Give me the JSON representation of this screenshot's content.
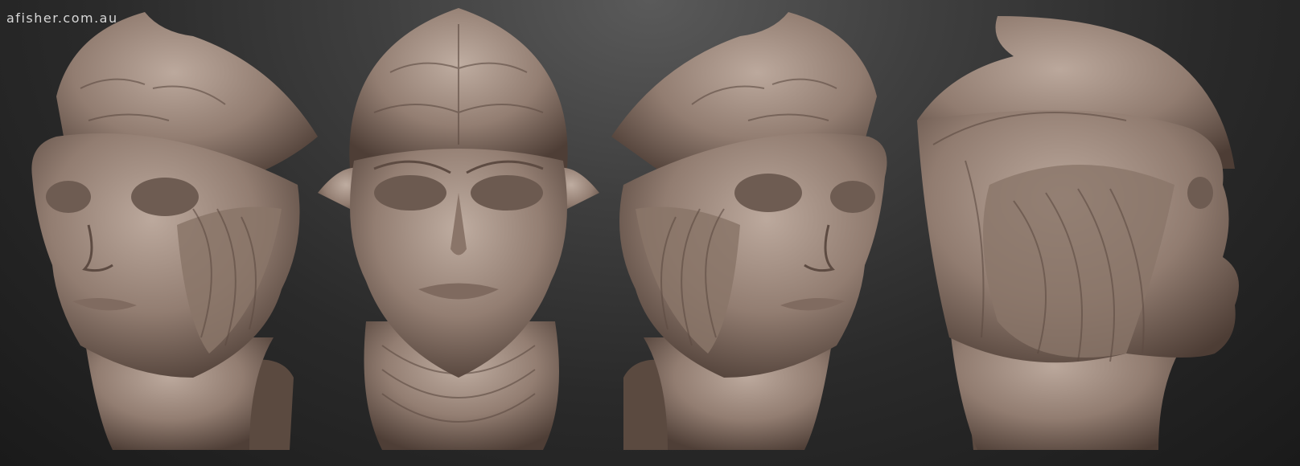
{
  "watermark": {
    "text": "afisher.com.au"
  },
  "colors": {
    "background_top": "#5a5a5a",
    "background_bottom": "#1a1a1a",
    "clay_light": "#b9a79c",
    "clay_mid": "#8f7b70",
    "clay_dark": "#4e3e36",
    "base_cut": "#5b4a40"
  },
  "views": [
    {
      "name": "three-quarter-left"
    },
    {
      "name": "front"
    },
    {
      "name": "three-quarter-right"
    },
    {
      "name": "profile-right"
    }
  ]
}
